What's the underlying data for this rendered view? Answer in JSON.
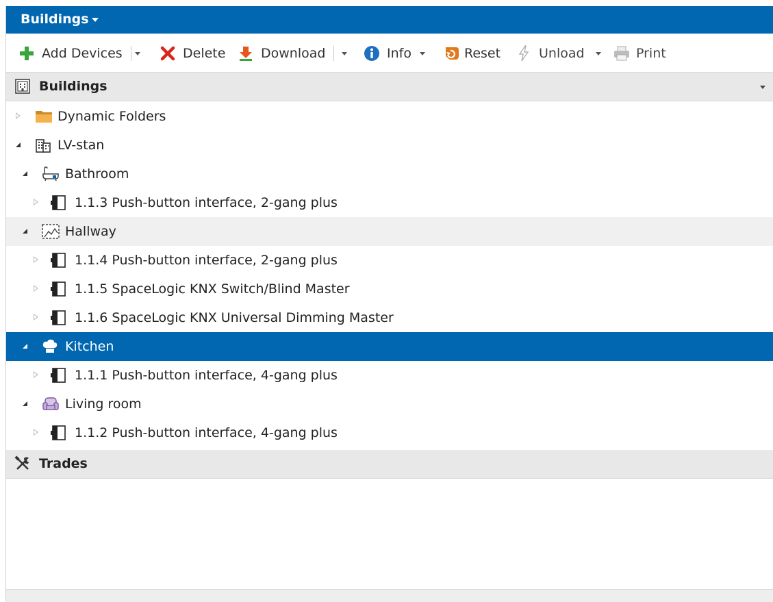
{
  "header": {
    "title": "Buildings"
  },
  "toolbar": {
    "add_devices": "Add Devices",
    "delete": "Delete",
    "download": "Download",
    "info": "Info",
    "reset": "Reset",
    "unload": "Unload",
    "print": "Print"
  },
  "sections": {
    "buildings": "Buildings",
    "trades": "Trades"
  },
  "tree": {
    "dynamic_folders": "Dynamic Folders",
    "lv_stan": "LV-stan",
    "bathroom": "Bathroom",
    "dev_113": "1.1.3 Push-button interface, 2-gang plus",
    "hallway": "Hallway",
    "dev_114": "1.1.4 Push-button interface, 2-gang plus",
    "dev_115": "1.1.5 SpaceLogic KNX Switch/Blind Master",
    "dev_116": "1.1.6 SpaceLogic KNX Universal Dimming Master",
    "kitchen": "Kitchen",
    "dev_111": "1.1.1 Push-button interface, 4-gang plus",
    "living_room": "Living room",
    "dev_112": "1.1.2 Push-button interface, 4-gang plus"
  },
  "colors": {
    "accent": "#0067b0",
    "add": "#3aa53a",
    "delete": "#d9261c",
    "download": "#e8551f",
    "info": "#1f6fc0",
    "reset": "#e07a1f"
  },
  "icons": {
    "add": "plus-icon",
    "delete": "x-icon",
    "download": "download-arrow-icon",
    "info": "info-icon",
    "reset": "reset-icon",
    "unload": "lightning-icon",
    "print": "printer-icon",
    "buildings": "building-icon",
    "trades": "tools-icon",
    "folder": "folder-icon",
    "device": "device-icon"
  }
}
